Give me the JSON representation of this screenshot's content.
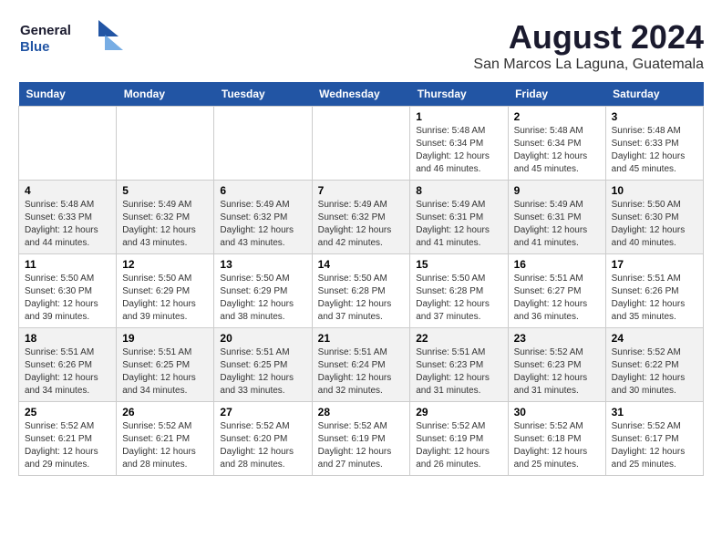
{
  "header": {
    "logo_general": "General",
    "logo_blue": "Blue",
    "title": "August 2024",
    "subtitle": "San Marcos La Laguna, Guatemala"
  },
  "weekdays": [
    "Sunday",
    "Monday",
    "Tuesday",
    "Wednesday",
    "Thursday",
    "Friday",
    "Saturday"
  ],
  "weeks": [
    [
      {
        "day": "",
        "info": ""
      },
      {
        "day": "",
        "info": ""
      },
      {
        "day": "",
        "info": ""
      },
      {
        "day": "",
        "info": ""
      },
      {
        "day": "1",
        "info": "Sunrise: 5:48 AM\nSunset: 6:34 PM\nDaylight: 12 hours\nand 46 minutes."
      },
      {
        "day": "2",
        "info": "Sunrise: 5:48 AM\nSunset: 6:34 PM\nDaylight: 12 hours\nand 45 minutes."
      },
      {
        "day": "3",
        "info": "Sunrise: 5:48 AM\nSunset: 6:33 PM\nDaylight: 12 hours\nand 45 minutes."
      }
    ],
    [
      {
        "day": "4",
        "info": "Sunrise: 5:48 AM\nSunset: 6:33 PM\nDaylight: 12 hours\nand 44 minutes."
      },
      {
        "day": "5",
        "info": "Sunrise: 5:49 AM\nSunset: 6:32 PM\nDaylight: 12 hours\nand 43 minutes."
      },
      {
        "day": "6",
        "info": "Sunrise: 5:49 AM\nSunset: 6:32 PM\nDaylight: 12 hours\nand 43 minutes."
      },
      {
        "day": "7",
        "info": "Sunrise: 5:49 AM\nSunset: 6:32 PM\nDaylight: 12 hours\nand 42 minutes."
      },
      {
        "day": "8",
        "info": "Sunrise: 5:49 AM\nSunset: 6:31 PM\nDaylight: 12 hours\nand 41 minutes."
      },
      {
        "day": "9",
        "info": "Sunrise: 5:49 AM\nSunset: 6:31 PM\nDaylight: 12 hours\nand 41 minutes."
      },
      {
        "day": "10",
        "info": "Sunrise: 5:50 AM\nSunset: 6:30 PM\nDaylight: 12 hours\nand 40 minutes."
      }
    ],
    [
      {
        "day": "11",
        "info": "Sunrise: 5:50 AM\nSunset: 6:30 PM\nDaylight: 12 hours\nand 39 minutes."
      },
      {
        "day": "12",
        "info": "Sunrise: 5:50 AM\nSunset: 6:29 PM\nDaylight: 12 hours\nand 39 minutes."
      },
      {
        "day": "13",
        "info": "Sunrise: 5:50 AM\nSunset: 6:29 PM\nDaylight: 12 hours\nand 38 minutes."
      },
      {
        "day": "14",
        "info": "Sunrise: 5:50 AM\nSunset: 6:28 PM\nDaylight: 12 hours\nand 37 minutes."
      },
      {
        "day": "15",
        "info": "Sunrise: 5:50 AM\nSunset: 6:28 PM\nDaylight: 12 hours\nand 37 minutes."
      },
      {
        "day": "16",
        "info": "Sunrise: 5:51 AM\nSunset: 6:27 PM\nDaylight: 12 hours\nand 36 minutes."
      },
      {
        "day": "17",
        "info": "Sunrise: 5:51 AM\nSunset: 6:26 PM\nDaylight: 12 hours\nand 35 minutes."
      }
    ],
    [
      {
        "day": "18",
        "info": "Sunrise: 5:51 AM\nSunset: 6:26 PM\nDaylight: 12 hours\nand 34 minutes."
      },
      {
        "day": "19",
        "info": "Sunrise: 5:51 AM\nSunset: 6:25 PM\nDaylight: 12 hours\nand 34 minutes."
      },
      {
        "day": "20",
        "info": "Sunrise: 5:51 AM\nSunset: 6:25 PM\nDaylight: 12 hours\nand 33 minutes."
      },
      {
        "day": "21",
        "info": "Sunrise: 5:51 AM\nSunset: 6:24 PM\nDaylight: 12 hours\nand 32 minutes."
      },
      {
        "day": "22",
        "info": "Sunrise: 5:51 AM\nSunset: 6:23 PM\nDaylight: 12 hours\nand 31 minutes."
      },
      {
        "day": "23",
        "info": "Sunrise: 5:52 AM\nSunset: 6:23 PM\nDaylight: 12 hours\nand 31 minutes."
      },
      {
        "day": "24",
        "info": "Sunrise: 5:52 AM\nSunset: 6:22 PM\nDaylight: 12 hours\nand 30 minutes."
      }
    ],
    [
      {
        "day": "25",
        "info": "Sunrise: 5:52 AM\nSunset: 6:21 PM\nDaylight: 12 hours\nand 29 minutes."
      },
      {
        "day": "26",
        "info": "Sunrise: 5:52 AM\nSunset: 6:21 PM\nDaylight: 12 hours\nand 28 minutes."
      },
      {
        "day": "27",
        "info": "Sunrise: 5:52 AM\nSunset: 6:20 PM\nDaylight: 12 hours\nand 28 minutes."
      },
      {
        "day": "28",
        "info": "Sunrise: 5:52 AM\nSunset: 6:19 PM\nDaylight: 12 hours\nand 27 minutes."
      },
      {
        "day": "29",
        "info": "Sunrise: 5:52 AM\nSunset: 6:19 PM\nDaylight: 12 hours\nand 26 minutes."
      },
      {
        "day": "30",
        "info": "Sunrise: 5:52 AM\nSunset: 6:18 PM\nDaylight: 12 hours\nand 25 minutes."
      },
      {
        "day": "31",
        "info": "Sunrise: 5:52 AM\nSunset: 6:17 PM\nDaylight: 12 hours\nand 25 minutes."
      }
    ]
  ]
}
